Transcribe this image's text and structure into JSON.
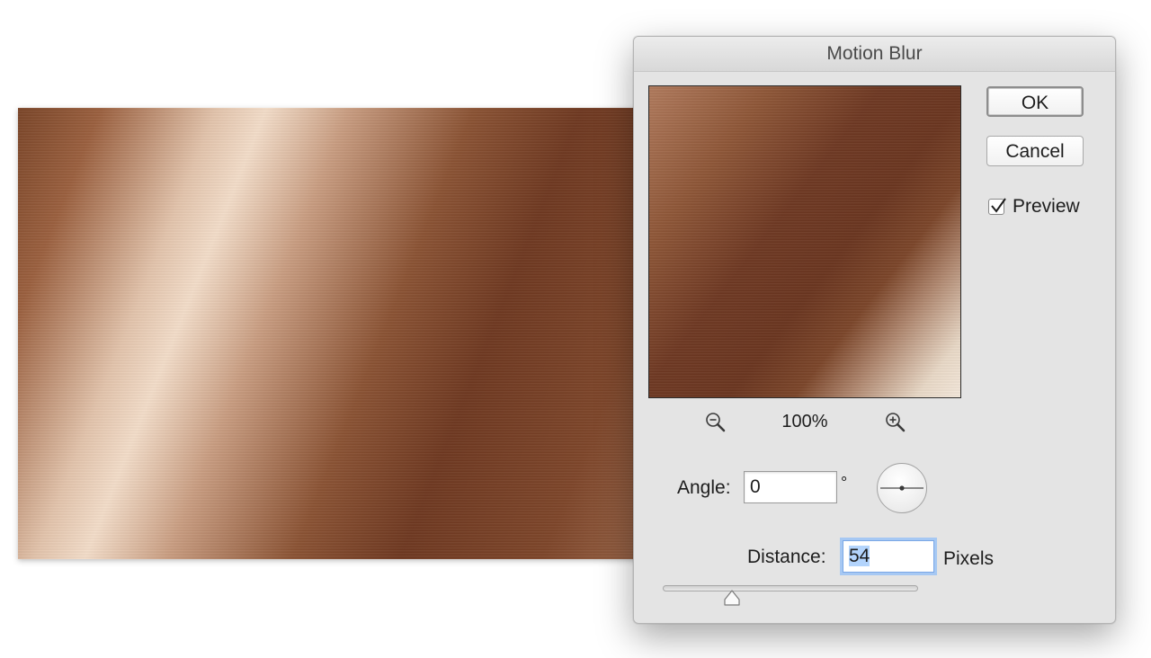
{
  "dialog": {
    "title": "Motion Blur",
    "ok_label": "OK",
    "cancel_label": "Cancel",
    "preview_label": "Preview",
    "preview_checked": true,
    "zoom_level": "100%",
    "zoom_out_icon": "zoom-out-icon",
    "zoom_in_icon": "zoom-in-icon",
    "angle_label": "Angle:",
    "angle_value": "0",
    "angle_unit": "°",
    "distance_label": "Distance:",
    "distance_value": "54",
    "distance_unit": "Pixels",
    "distance_slider_fraction": 0.27
  },
  "colors": {
    "copper_dark": "#6e3822",
    "copper_light": "#f2dcc8",
    "dialog_bg": "#e4e4e4",
    "focus_ring": "#a6c8f3"
  }
}
